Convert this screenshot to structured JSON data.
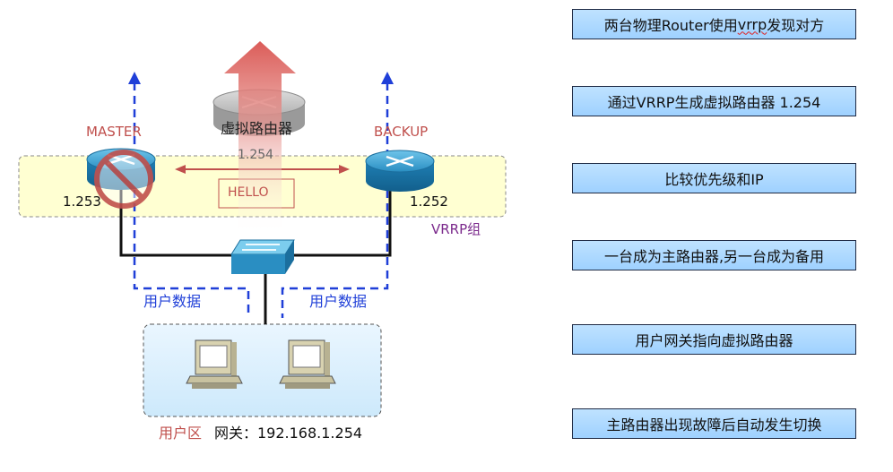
{
  "diagram": {
    "master_label": "MASTER",
    "backup_label": "BACKUP",
    "virtual_router_label": "虚拟路由器",
    "virtual_ip": "1.254",
    "hello_label": "HELLO",
    "master_ip": "1.253",
    "backup_ip": "1.252",
    "vrrp_group_label": "VRRP组",
    "user_data_left": "用户数据",
    "user_data_right": "用户数据",
    "user_area_label": "用户区",
    "gateway_label": "网关：192.168.1.254"
  },
  "steps": {
    "step1_pre": "两台物理Router使用",
    "step1_word": "vrrp",
    "step1_post": "发现对方",
    "step2": "通过VRRP生成虚拟路由器 1.254",
    "step3": "比较优先级和IP",
    "step4": "一台成为主路由器,另一台成为备用",
    "step5": "用户网关指向虚拟路由器",
    "step6": "主路由器出现故障后自动发生切换"
  },
  "colors": {
    "label_red": "#c0504d",
    "data_blue": "#1f3fd8",
    "vrrp_purple": "#7b2a8c",
    "step_fill": "#a6d4ff"
  }
}
